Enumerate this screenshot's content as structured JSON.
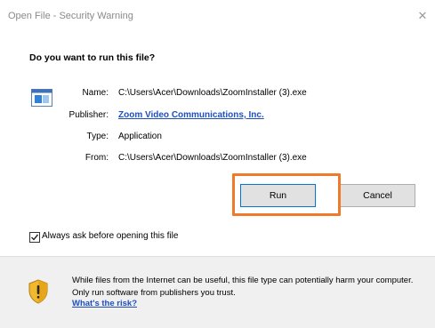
{
  "window": {
    "title": "Open File - Security Warning",
    "close_glyph": "✕"
  },
  "dialog": {
    "question": "Do you want to run this file?",
    "file_icon": "application-file-icon",
    "rows": [
      {
        "label": "Name:",
        "value": "C:\\Users\\Acer\\Downloads\\ZoomInstaller (3).exe"
      },
      {
        "label": "Publisher:",
        "value": "Zoom Video Communications, Inc."
      },
      {
        "label": "Type:",
        "value": "Application"
      },
      {
        "label": "From:",
        "value": "C:\\Users\\Acer\\Downloads\\ZoomInstaller (3).exe"
      }
    ],
    "buttons": {
      "run": "Run",
      "cancel": "Cancel"
    },
    "always_ask": {
      "checked": true,
      "label": "Always ask before opening this file"
    }
  },
  "footer": {
    "icon": "shield-warning-icon",
    "warning": "While files from the Internet can be useful, this file type can potentially harm your computer. Only run software from publishers you trust.",
    "link": "What's the risk?"
  },
  "colors": {
    "highlight": "#ef7b2a",
    "link": "#1f4fbf",
    "footer_bg": "#f0f0f0"
  }
}
